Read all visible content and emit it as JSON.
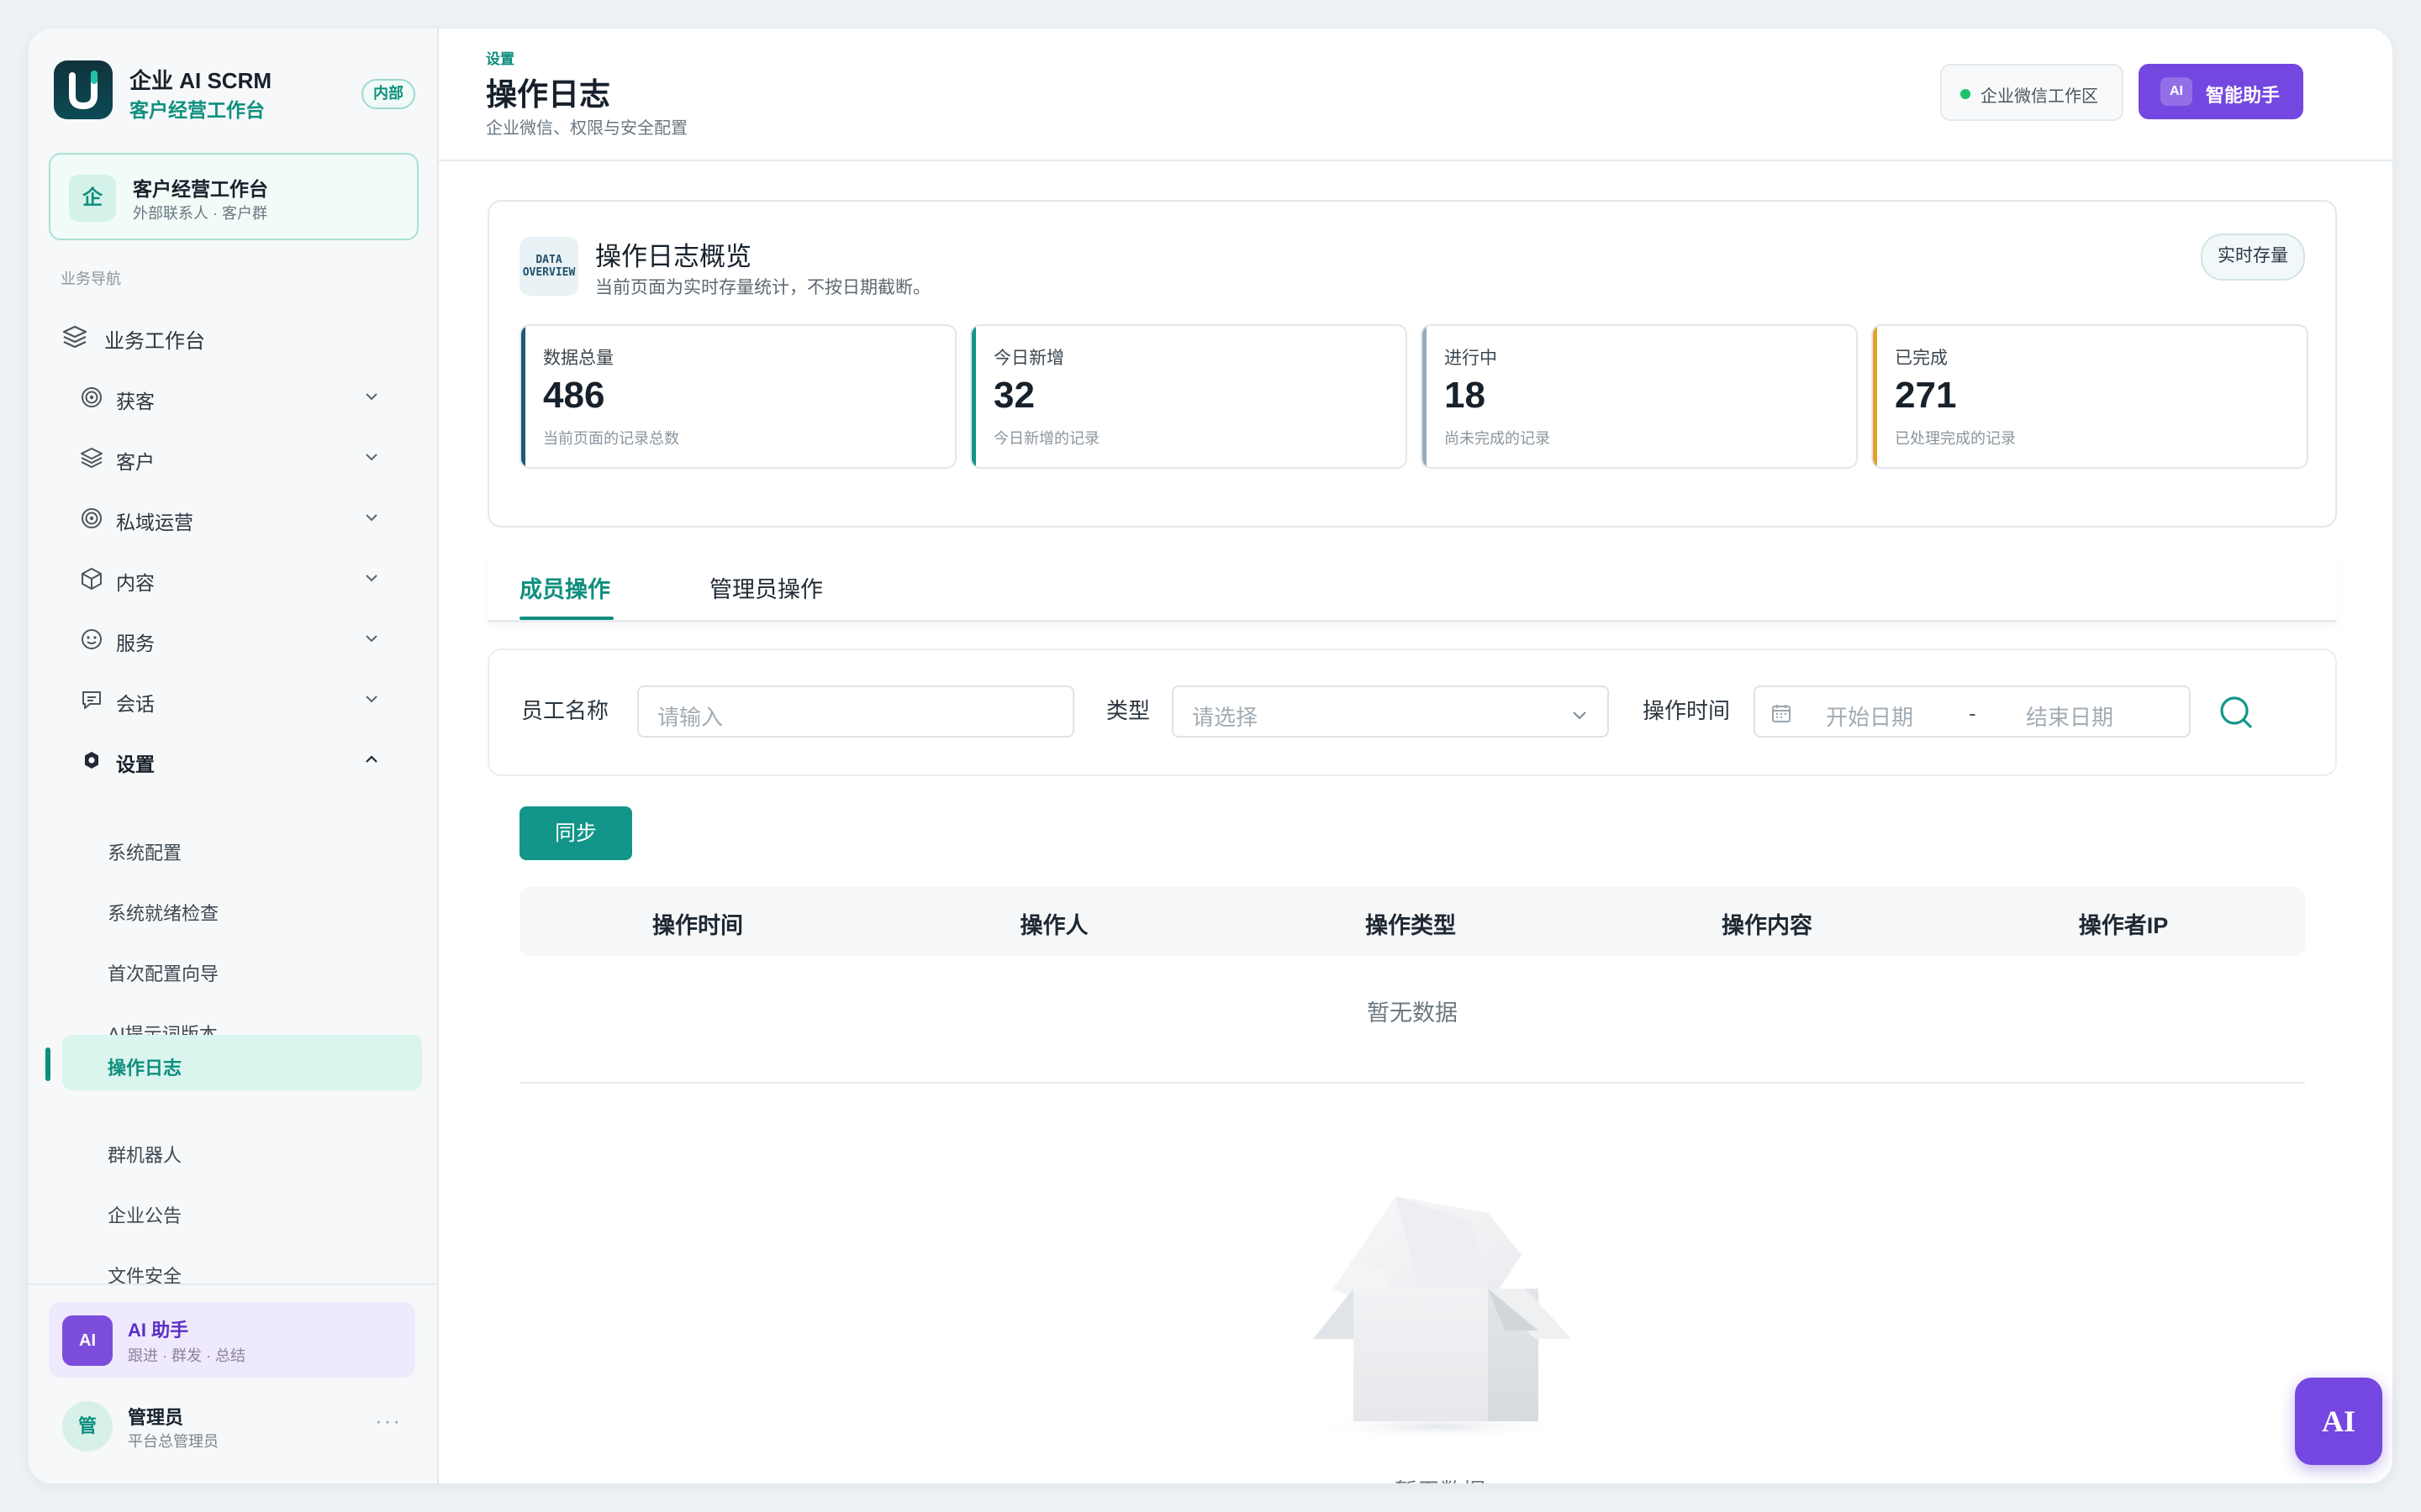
{
  "brand": {
    "title": "企业 AI SCRM",
    "subtitle": "客户经营工作台",
    "badge": "内部",
    "logo_letter": "U",
    "logo_icon": "brand-logo-icon"
  },
  "workspace_card": {
    "icon": "企",
    "title": "客户经营工作台",
    "subtitle": "外部联系人 · 客户群"
  },
  "sidebar": {
    "section_label": "业务导航",
    "top_item": {
      "label": "业务工作台",
      "icon": "layers-icon"
    },
    "items": [
      {
        "label": "获客",
        "icon": "target-icon",
        "expanded": false
      },
      {
        "label": "客户",
        "icon": "layers-icon",
        "expanded": false
      },
      {
        "label": "私域运营",
        "icon": "target-icon",
        "expanded": false
      },
      {
        "label": "内容",
        "icon": "cube-icon",
        "expanded": false
      },
      {
        "label": "服务",
        "icon": "smile-icon",
        "expanded": false
      },
      {
        "label": "会话",
        "icon": "chat-icon",
        "expanded": false
      },
      {
        "label": "设置",
        "icon": "settings-icon",
        "expanded": true
      }
    ],
    "sub_items": [
      {
        "label": "系统配置",
        "active": false
      },
      {
        "label": "系统就绪检查",
        "active": false
      },
      {
        "label": "首次配置向导",
        "active": false
      },
      {
        "label": "AI提示词版本",
        "active": false
      },
      {
        "label": "操作日志",
        "active": true
      },
      {
        "label": "群机器人",
        "active": false
      },
      {
        "label": "企业公告",
        "active": false
      },
      {
        "label": "文件安全",
        "active": false
      }
    ],
    "ai_card": {
      "icon": "AI",
      "title": "AI 助手",
      "subtitle": "跟进 · 群发 · 总结"
    },
    "user": {
      "avatar": "管",
      "name": "管理员",
      "role": "平台总管理员",
      "more": "···"
    }
  },
  "header": {
    "breadcrumb": "设置",
    "title": "操作日志",
    "subtitle": "企业微信、权限与安全配置",
    "workspace_chip": "企业微信工作区",
    "ai_button": {
      "badge": "AI",
      "label": "智能助手"
    }
  },
  "overview": {
    "icon_text": [
      "DATA",
      "OVERVIEW"
    ],
    "title": "操作日志概览",
    "subtitle": "当前页面为实时存量统计，不按日期截断。",
    "tag": "实时存量",
    "stats": [
      {
        "label": "数据总量",
        "value": "486",
        "sub": "当前页面的记录总数",
        "color": "#1c5a78"
      },
      {
        "label": "今日新增",
        "value": "32",
        "sub": "今日新增的记录",
        "color": "#13968a"
      },
      {
        "label": "进行中",
        "value": "18",
        "sub": "尚未完成的记录",
        "color": "#9aabb8"
      },
      {
        "label": "已完成",
        "value": "271",
        "sub": "已处理完成的记录",
        "color": "#e3a02e"
      }
    ]
  },
  "tabs": [
    {
      "label": "成员操作",
      "active": true
    },
    {
      "label": "管理员操作",
      "active": false
    }
  ],
  "filter": {
    "employee_label": "员工名称",
    "employee_placeholder": "请输入",
    "type_label": "类型",
    "type_placeholder": "请选择",
    "time_label": "操作时间",
    "start_placeholder": "开始日期",
    "separator": "-",
    "end_placeholder": "结束日期"
  },
  "table": {
    "sync_button": "同步",
    "columns": [
      "操作时间",
      "操作人",
      "操作类型",
      "操作内容",
      "操作者IP"
    ],
    "empty_row": "暂无数据",
    "empty_text": "暂无数据"
  },
  "float_ai": "AI",
  "colors": {
    "accent": "#0e8f7e",
    "primary_button": "#13968a",
    "ai_purple": "#7447e0"
  }
}
